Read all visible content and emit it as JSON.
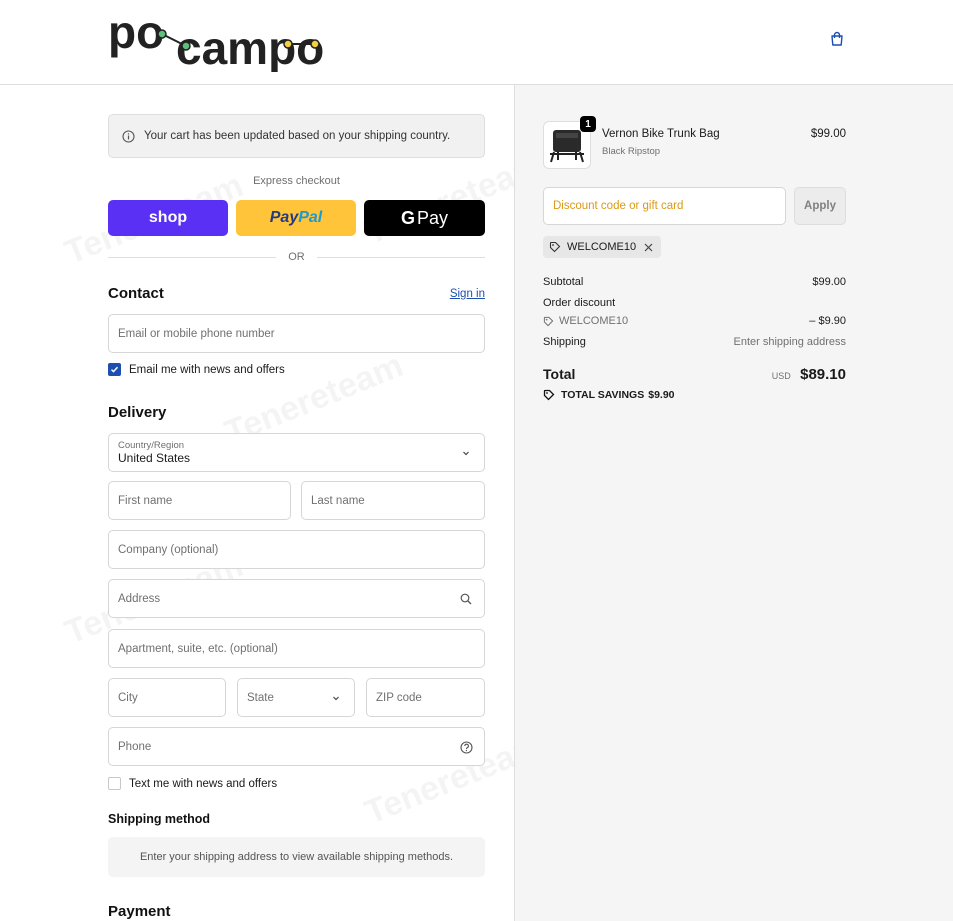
{
  "brand": {
    "logo_text": "po campo",
    "accent": "#5a31f4"
  },
  "header": {
    "bag_icon": "shopping-bag-icon"
  },
  "notice": {
    "text": "Your cart has been updated based on your shipping country."
  },
  "express": {
    "label": "Express checkout",
    "shop_label": "shop",
    "paypal_label_1": "Pay",
    "paypal_label_2": "Pal",
    "gpay_g": "G",
    "gpay_label": "Pay",
    "or_label": "OR"
  },
  "contact": {
    "title": "Contact",
    "signin": "Sign in",
    "email_placeholder": "Email or mobile phone number",
    "news_label": "Email me with news and offers",
    "news_checked": true
  },
  "delivery": {
    "title": "Delivery",
    "country_label": "Country/Region",
    "country_value": "United States",
    "first_name": "First name",
    "last_name": "Last name",
    "company": "Company (optional)",
    "address": "Address",
    "apartment": "Apartment, suite, etc. (optional)",
    "city": "City",
    "state": "State",
    "zip": "ZIP code",
    "phone": "Phone",
    "text_label": "Text me with news and offers",
    "text_checked": false
  },
  "shipping": {
    "title": "Shipping method",
    "message": "Enter your shipping address to view available shipping methods."
  },
  "payment": {
    "title": "Payment"
  },
  "order": {
    "product": {
      "name": "Vernon Bike Trunk Bag",
      "variant": "Black Ripstop",
      "price": "$99.00",
      "qty": "1"
    },
    "discount_placeholder": "Discount code or gift card",
    "apply_label": "Apply",
    "code_chip": "WELCOME10",
    "subtotal_label": "Subtotal",
    "subtotal_value": "$99.00",
    "order_discount_label": "Order discount",
    "discount_code": "WELCOME10",
    "discount_value": "– $9.90",
    "shipping_label": "Shipping",
    "shipping_value": "Enter shipping address",
    "total_label": "Total",
    "currency": "USD",
    "total_value": "$89.10",
    "savings_label": "TOTAL SAVINGS",
    "savings_value": "$9.90"
  }
}
